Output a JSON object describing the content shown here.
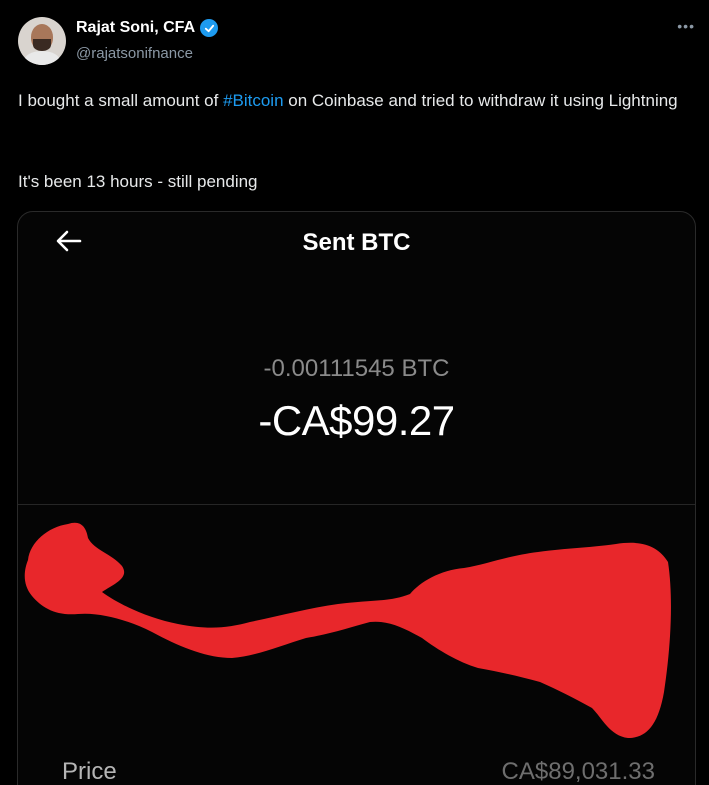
{
  "author": {
    "name": "Rajat Soni, CFA",
    "handle": "@rajatsonifnance"
  },
  "tweet": {
    "text_before": "I bought a small amount of ",
    "hashtag": "#Bitcoin",
    "text_after": " on Coinbase and tried to withdraw it using Lightning",
    "line2": "It's been 13 hours - still pending"
  },
  "screenshot": {
    "title": "Sent BTC",
    "btc_amount": "-0.00111545 BTC",
    "fiat_amount": "-CA$99.27",
    "price_label": "Price",
    "price_value": "CA$89,031.33"
  },
  "colors": {
    "accent": "#1d9bf0",
    "redaction": "#e8272b",
    "background": "#000000"
  },
  "icons": {
    "verified": "verified-badge-icon",
    "more": "more-options-icon",
    "back": "back-arrow-icon"
  }
}
